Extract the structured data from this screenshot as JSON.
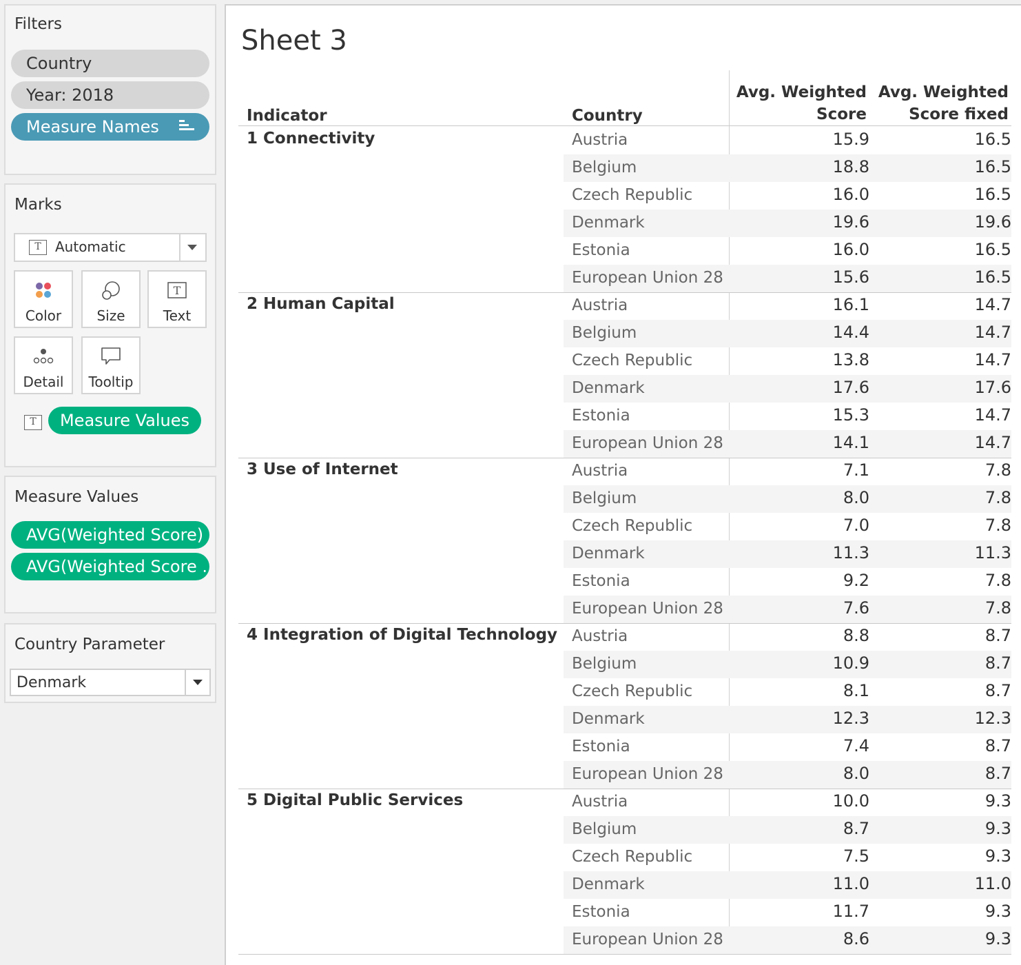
{
  "filters": {
    "title": "Filters",
    "pills": [
      "Country",
      "Year: 2018",
      "Measure Names"
    ]
  },
  "marks": {
    "title": "Marks",
    "mark_type": "Automatic",
    "buttons": [
      "Color",
      "Size",
      "Text",
      "Detail",
      "Tooltip"
    ],
    "text_pill": "Measure Values"
  },
  "measure_values": {
    "title": "Measure Values",
    "pills": [
      "AVG(Weighted Score)",
      "AVG(Weighted Score .."
    ]
  },
  "country_parameter": {
    "title": "Country Parameter",
    "value": "Denmark"
  },
  "sheet": {
    "title": "Sheet 3",
    "headers": {
      "indicator": "Indicator",
      "country": "Country",
      "col1_line1": "Avg. Weighted",
      "col1_line2": "Score",
      "col2_line1": "Avg. Weighted",
      "col2_line2": "Score fixed"
    },
    "groups": [
      {
        "indicator": "1 Connectivity",
        "rows": [
          {
            "country": "Austria",
            "score": "15.9",
            "fixed": "16.5"
          },
          {
            "country": "Belgium",
            "score": "18.8",
            "fixed": "16.5"
          },
          {
            "country": "Czech Republic",
            "score": "16.0",
            "fixed": "16.5"
          },
          {
            "country": "Denmark",
            "score": "19.6",
            "fixed": "19.6"
          },
          {
            "country": "Estonia",
            "score": "16.0",
            "fixed": "16.5"
          },
          {
            "country": "European Union 28",
            "score": "15.6",
            "fixed": "16.5"
          }
        ]
      },
      {
        "indicator": "2 Human Capital",
        "rows": [
          {
            "country": "Austria",
            "score": "16.1",
            "fixed": "14.7"
          },
          {
            "country": "Belgium",
            "score": "14.4",
            "fixed": "14.7"
          },
          {
            "country": "Czech Republic",
            "score": "13.8",
            "fixed": "14.7"
          },
          {
            "country": "Denmark",
            "score": "17.6",
            "fixed": "17.6"
          },
          {
            "country": "Estonia",
            "score": "15.3",
            "fixed": "14.7"
          },
          {
            "country": "European Union 28",
            "score": "14.1",
            "fixed": "14.7"
          }
        ]
      },
      {
        "indicator": "3 Use of Internet",
        "rows": [
          {
            "country": "Austria",
            "score": "7.1",
            "fixed": "7.8"
          },
          {
            "country": "Belgium",
            "score": "8.0",
            "fixed": "7.8"
          },
          {
            "country": "Czech Republic",
            "score": "7.0",
            "fixed": "7.8"
          },
          {
            "country": "Denmark",
            "score": "11.3",
            "fixed": "11.3"
          },
          {
            "country": "Estonia",
            "score": "9.2",
            "fixed": "7.8"
          },
          {
            "country": "European Union 28",
            "score": "7.6",
            "fixed": "7.8"
          }
        ]
      },
      {
        "indicator": "4 Integration of Digital Technology",
        "rows": [
          {
            "country": "Austria",
            "score": "8.8",
            "fixed": "8.7"
          },
          {
            "country": "Belgium",
            "score": "10.9",
            "fixed": "8.7"
          },
          {
            "country": "Czech Republic",
            "score": "8.1",
            "fixed": "8.7"
          },
          {
            "country": "Denmark",
            "score": "12.3",
            "fixed": "12.3"
          },
          {
            "country": "Estonia",
            "score": "7.4",
            "fixed": "8.7"
          },
          {
            "country": "European Union 28",
            "score": "8.0",
            "fixed": "8.7"
          }
        ]
      },
      {
        "indicator": "5 Digital Public Services",
        "rows": [
          {
            "country": "Austria",
            "score": "10.0",
            "fixed": "9.3"
          },
          {
            "country": "Belgium",
            "score": "8.7",
            "fixed": "9.3"
          },
          {
            "country": "Czech Republic",
            "score": "7.5",
            "fixed": "9.3"
          },
          {
            "country": "Denmark",
            "score": "11.0",
            "fixed": "11.0"
          },
          {
            "country": "Estonia",
            "score": "11.7",
            "fixed": "9.3"
          },
          {
            "country": "European Union 28",
            "score": "8.6",
            "fixed": "9.3"
          }
        ]
      }
    ]
  },
  "colors": {
    "pill_gray": "#d6d6d6",
    "pill_blue": "#4a9ab5",
    "pill_green": "#00b180",
    "row_shade": "#f4f4f4"
  }
}
